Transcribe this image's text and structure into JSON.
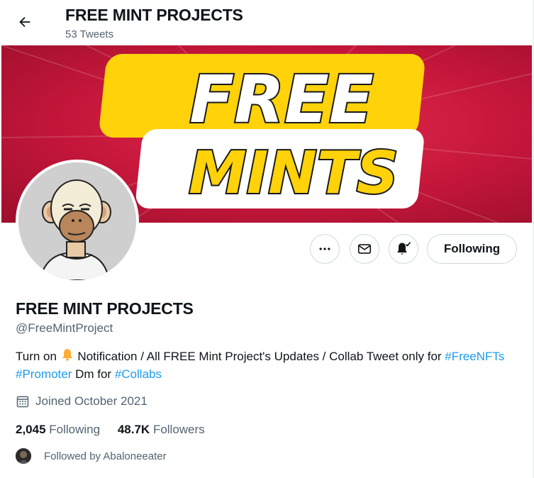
{
  "header": {
    "title": "FREE MINT PROJECTS",
    "tweet_count": "53 Tweets"
  },
  "banner": {
    "line1": "FREE",
    "line2": "MINTS",
    "colors": {
      "background": "#c4163a",
      "yellow": "#ffd20a",
      "white": "#ffffff"
    }
  },
  "actions": {
    "more_icon": "more-icon",
    "message_icon": "mail-icon",
    "notify_icon": "bell-check-icon",
    "follow_label": "Following"
  },
  "profile": {
    "name": "FREE MINT PROJECTS",
    "handle": "@FreeMintProject",
    "bio": {
      "part1": "Turn on ",
      "part2": " Notification / All FREE Mint Project's Updates / Collab Tweet only for ",
      "tag1": "#FreeNFTs",
      "tag2": "#Promoter",
      "part3": " Dm for ",
      "tag3": "#Collabs"
    },
    "joined": "Joined October 2021",
    "following_count": "2,045",
    "following_label": "Following",
    "followers_count": "48.7K",
    "followers_label": "Followers",
    "followed_by": "Followed by Abaloneeater"
  },
  "colors": {
    "link": "#1d9bf0",
    "secondary_text": "#536471",
    "primary_text": "#0f1419"
  }
}
